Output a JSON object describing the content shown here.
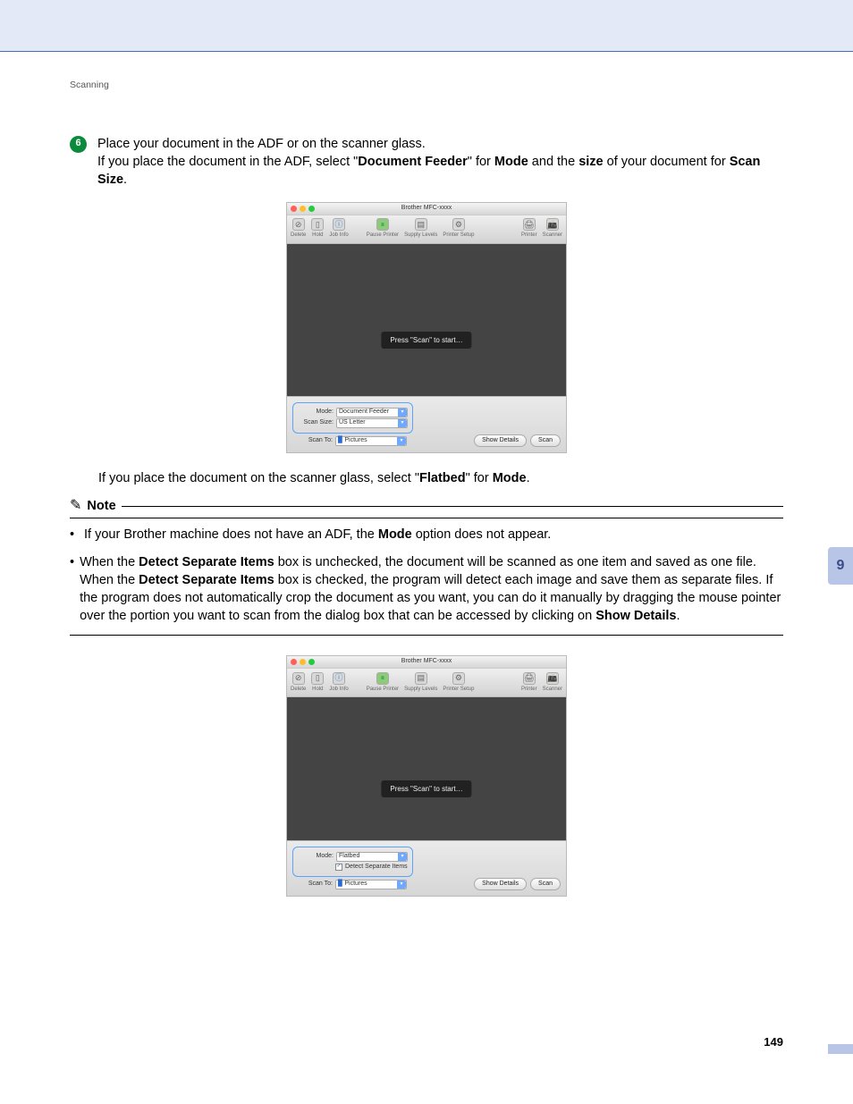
{
  "breadcrumb": "Scanning",
  "step": {
    "number": "6",
    "line1_a": "Place your document in the ADF or on the scanner glass.",
    "line2_a": "If you place the document in the ADF, select \"",
    "line2_b": "Document Feeder",
    "line2_c": "\" for ",
    "line2_d": "Mode",
    "line2_e": " and the ",
    "line2_f": "size",
    "line2_g": " of your document for ",
    "line2_h": "Scan Size",
    "line2_i": "."
  },
  "mid_line": {
    "a": "If you place the document on the scanner glass, select \"",
    "b": "Flatbed",
    "c": "\" for ",
    "d": "Mode",
    "e": "."
  },
  "note": {
    "label": "Note",
    "item1": {
      "a": "If your Brother machine does not have an ADF, the ",
      "b": "Mode",
      "c": " option does not appear."
    },
    "item2": {
      "a": "When the ",
      "b": "Detect Separate Items",
      "c": " box is unchecked, the document will be scanned as one item and saved as one file. When the ",
      "d": "Detect Separate Items",
      "e": " box is checked, the program will detect each image and save them as separate files. If the program does not automatically crop the document as you want, you can do it manually by dragging the mouse pointer over the portion you want to scan from the dialog box that can be accessed by clicking on ",
      "f": "Show Details",
      "g": "."
    }
  },
  "screenshot": {
    "title": "Brother MFC-xxxx",
    "toolbar": {
      "delete": "Delete",
      "hold": "Hold",
      "jobinfo": "Job Info",
      "pause": "Pause Printer",
      "supply": "Supply Levels",
      "setup": "Printer Setup",
      "printer": "Printer",
      "scanner": "Scanner"
    },
    "tooltip": "Press \"Scan\" to start…",
    "labels": {
      "mode": "Mode:",
      "scansize": "Scan Size:",
      "scanto": "Scan To:",
      "detect": "Detect Separate Items"
    },
    "values": {
      "mode_adf": "Document Feeder",
      "mode_flatbed": "Flatbed",
      "scansize": "US Letter",
      "scanto": "Pictures"
    },
    "buttons": {
      "showdetails": "Show Details",
      "scan": "Scan"
    }
  },
  "chapter": "9",
  "page_number": "149"
}
